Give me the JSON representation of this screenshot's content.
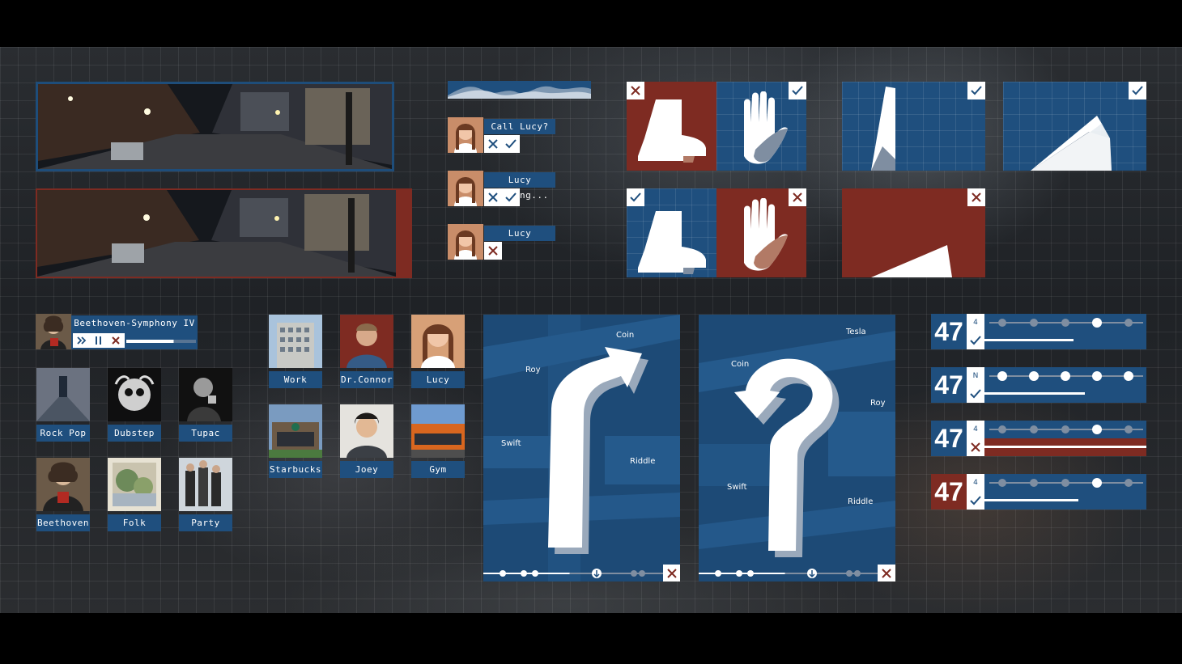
{
  "calls": [
    {
      "label": "Call Lucy?",
      "buttons": [
        "close-icon",
        "check-icon"
      ]
    },
    {
      "label": "Lucy Calling...",
      "buttons": [
        "close-icon",
        "check-icon"
      ]
    },
    {
      "label": "Lucy",
      "buttons": [
        "close-icon"
      ]
    }
  ],
  "music": {
    "now_playing": "Beethoven-Symphony IV",
    "progress": 0.68,
    "genres": [
      {
        "label": "Rock Pop",
        "icon": "album-art-icon"
      },
      {
        "label": "Dubstep",
        "icon": "album-art-icon"
      },
      {
        "label": "Tupac",
        "icon": "album-art-icon"
      },
      {
        "label": "Beethoven",
        "icon": "album-art-icon"
      },
      {
        "label": "Folk",
        "icon": "album-art-icon"
      },
      {
        "label": "Party",
        "icon": "album-art-icon"
      }
    ]
  },
  "contacts": [
    {
      "label": "Work"
    },
    {
      "label": "Dr.Connor"
    },
    {
      "label": "Lucy"
    },
    {
      "label": "Starbucks"
    },
    {
      "label": "Joey"
    },
    {
      "label": "Gym"
    }
  ],
  "map_left": {
    "streets": {
      "coin": "Coin",
      "roy": "Roy",
      "swift": "Swift",
      "riddle": "Riddle"
    },
    "progress": 0.48
  },
  "map_right": {
    "streets": {
      "tesla": "Tesla",
      "coin": "Coin",
      "roy": "Roy",
      "swift": "Swift",
      "riddle": "Riddle"
    },
    "progress": 0.48
  },
  "speed_rows": [
    {
      "speed": "47",
      "gear": "4",
      "status": "check",
      "level": 4,
      "progress": 0.55
    },
    {
      "speed": "47",
      "gear": "N",
      "status": "check",
      "level": 5,
      "progress": 0.62
    },
    {
      "speed": "47",
      "gear": "4",
      "status": "x",
      "level": 4,
      "progress": 1.0
    },
    {
      "speed": "47",
      "gear": "4",
      "status": "check",
      "level": 4,
      "progress": 0.58
    }
  ],
  "colors": {
    "blue": "#1f4f7e",
    "red": "#7e2b22",
    "white": "#ffffff"
  }
}
